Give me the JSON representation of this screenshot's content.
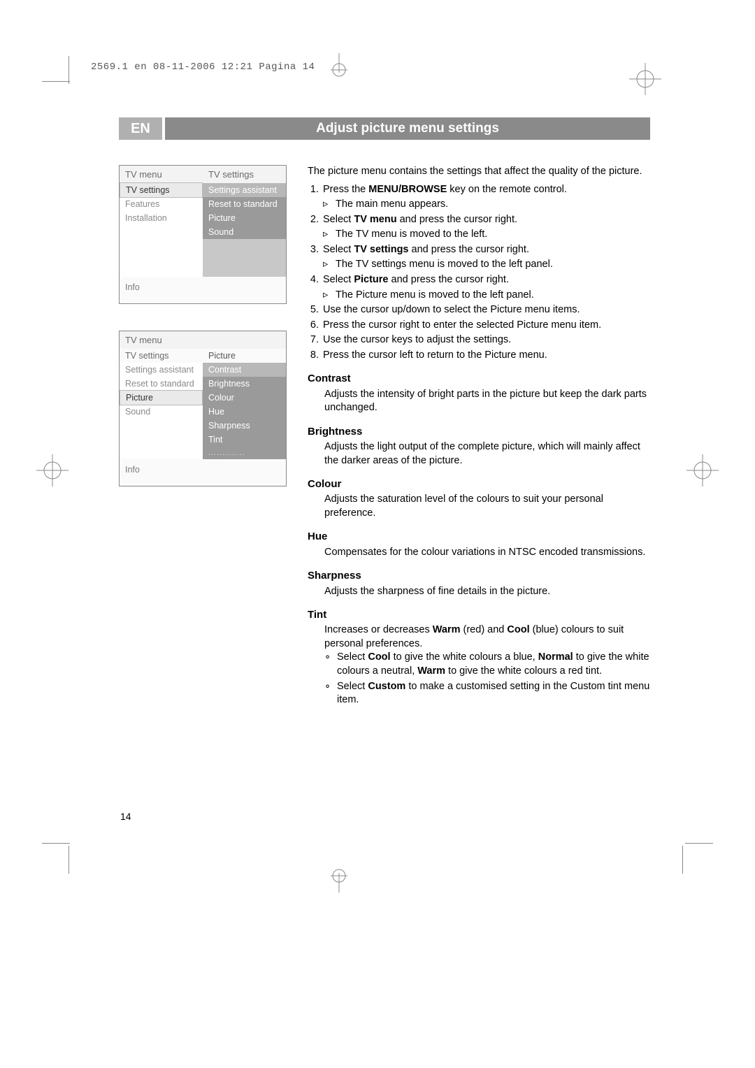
{
  "prepress_header": "2569.1 en  08-11-2006  12:21  Pagina 14",
  "lang_chip": "EN",
  "page_title": "Adjust picture menu settings",
  "page_number": "14",
  "menu1": {
    "header_left": "TV menu",
    "header_right": "TV settings",
    "left_items": [
      "TV settings",
      "Features",
      "Installation"
    ],
    "right_items": [
      "Settings assistant",
      "Reset to standard",
      "Picture",
      "Sound"
    ],
    "info": "Info"
  },
  "menu2": {
    "header": "TV menu",
    "sub_left": "TV settings",
    "sub_right": "Picture",
    "left_items": [
      "Settings assistant",
      "Reset to standard",
      "Picture",
      "Sound"
    ],
    "left_selected_index": 2,
    "right_items": [
      "Contrast",
      "Brightness",
      "Colour",
      "Hue",
      "Sharpness",
      "Tint",
      "............."
    ],
    "info": "Info"
  },
  "intro": "The picture menu contains the settings that affect the quality of the picture.",
  "steps": [
    {
      "n": "1.",
      "t_pre": "Press the ",
      "t_bold": "MENU/BROWSE",
      "t_post": " key on the remote control.",
      "sub": "The main menu appears."
    },
    {
      "n": "2.",
      "t_pre": "Select ",
      "t_bold": "TV menu",
      "t_post": " and press the cursor right.",
      "sub": "The TV menu is moved to the left."
    },
    {
      "n": "3.",
      "t_pre": "Select ",
      "t_bold": "TV settings",
      "t_post": " and press the cursor right.",
      "sub": "The TV settings menu is moved to the left panel."
    },
    {
      "n": "4.",
      "t_pre": "Select ",
      "t_bold": "Picture",
      "t_post": " and press the cursor right.",
      "sub": "The Picture menu is moved to the left panel."
    },
    {
      "n": "5.",
      "t_pre": "",
      "t_bold": "",
      "t_post": "Use the cursor up/down to select the Picture menu items.",
      "sub": ""
    },
    {
      "n": "6.",
      "t_pre": "",
      "t_bold": "",
      "t_post": "Press the cursor right to enter the selected Picture menu item.",
      "sub": ""
    },
    {
      "n": "7.",
      "t_pre": "",
      "t_bold": "",
      "t_post": "Use the cursor keys to adjust the settings.",
      "sub": ""
    },
    {
      "n": "8.",
      "t_pre": "",
      "t_bold": "",
      "t_post": "Press the cursor left to return to the Picture menu.",
      "sub": ""
    }
  ],
  "definitions": {
    "contrast": {
      "title": "Contrast",
      "body": "Adjusts the intensity of bright parts in the picture but keep the dark parts unchanged."
    },
    "brightness": {
      "title": "Brightness",
      "body": "Adjusts the light output of the complete picture, which will mainly affect the darker areas of the picture."
    },
    "colour": {
      "title": "Colour",
      "body": "Adjusts the saturation level of the colours to suit your personal preference."
    },
    "hue": {
      "title": "Hue",
      "body": "Compensates for the colour variations in NTSC encoded transmissions."
    },
    "sharpness": {
      "title": "Sharpness",
      "body": "Adjusts the sharpness of fine details in the picture."
    },
    "tint": {
      "title": "Tint",
      "intro_pre": "Increases or decreases ",
      "intro_warm": "Warm",
      "intro_mid": " (red) and ",
      "intro_cool": "Cool",
      "intro_post": " (blue) colours to suit personal preferences.",
      "b1_pre": "Select ",
      "b1_cool": "Cool",
      "b1_mid1": " to give the white colours a blue, ",
      "b1_normal": "Normal",
      "b1_mid2": " to give the white colours a neutral, ",
      "b1_warm": "Warm",
      "b1_post": " to give the white colours a red tint.",
      "b2_pre": "Select ",
      "b2_custom": "Custom",
      "b2_post": " to make a customised setting in the Custom tint menu item."
    }
  },
  "tri": "▹",
  "ring": "∘"
}
